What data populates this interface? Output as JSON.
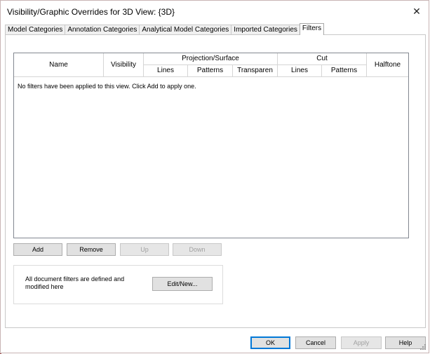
{
  "window": {
    "title": "Visibility/Graphic Overrides for 3D View: {3D}",
    "close_glyph": "✕"
  },
  "tabs": [
    {
      "label": "Model Categories"
    },
    {
      "label": "Annotation Categories"
    },
    {
      "label": "Analytical Model Categories"
    },
    {
      "label": "Imported Categories"
    },
    {
      "label": "Filters",
      "active": true
    }
  ],
  "grid": {
    "headers": {
      "name": "Name",
      "visibility": "Visibility",
      "projection_surface": "Projection/Surface",
      "proj_lines": "Lines",
      "proj_patterns": "Patterns",
      "proj_transparency": "Transparen",
      "cut": "Cut",
      "cut_lines": "Lines",
      "cut_patterns": "Patterns",
      "halftone": "Halftone"
    },
    "empty_message": "No filters have been applied to this view. Click Add to apply one."
  },
  "filter_buttons": {
    "add": "Add",
    "remove": "Remove",
    "up": "Up",
    "down": "Down"
  },
  "document_filters": {
    "text": "All document filters are defined and modified here",
    "edit_new": "Edit/New..."
  },
  "footer": {
    "ok": "OK",
    "cancel": "Cancel",
    "apply": "Apply",
    "help": "Help"
  }
}
